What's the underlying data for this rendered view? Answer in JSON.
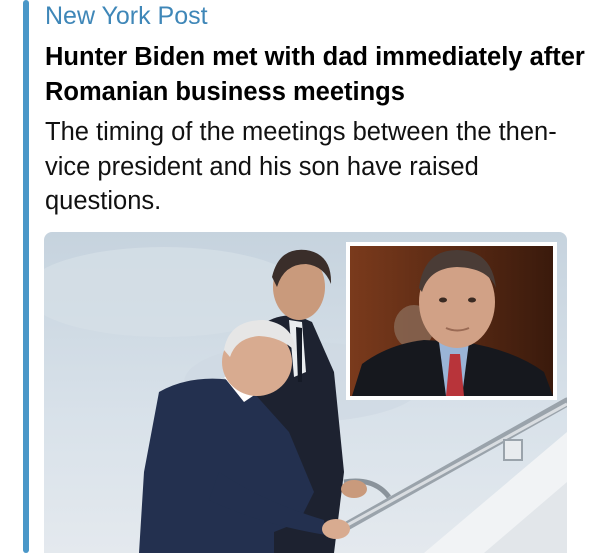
{
  "colors": {
    "accent": "#4a97c8",
    "site_name": "#3f87b8"
  },
  "link_preview": {
    "site_name": "New York Post",
    "title": "Hunter Biden met with dad immediately after Romanian business meetings",
    "description": "The timing of the meetings between the then-vice president and his son have raised questions.",
    "image_icon": "news-photo-icon"
  }
}
